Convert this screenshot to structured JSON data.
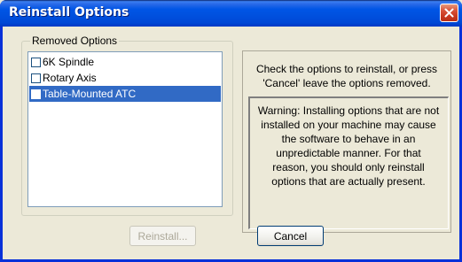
{
  "window": {
    "title": "Reinstall Options"
  },
  "group": {
    "label": "Removed Options",
    "items": [
      {
        "label": "6K Spindle",
        "checked": false,
        "selected": false
      },
      {
        "label": "Rotary Axis",
        "checked": false,
        "selected": false
      },
      {
        "label": "Table-Mounted ATC",
        "checked": false,
        "selected": true
      }
    ]
  },
  "info": {
    "line1": "Check the options to reinstall, or press",
    "line2": "'Cancel' leave the options removed."
  },
  "warning": {
    "lines": [
      "Warning: Installing options that are not",
      "installed on your machine may cause",
      "the software to behave in an",
      "unpredictable manner.  For that",
      "reason, you should only reinstall",
      "options that are actually present."
    ]
  },
  "buttons": {
    "reinstall": "Reinstall...",
    "cancel": "Cancel"
  },
  "colors": {
    "titlebar": "#0055E5",
    "selection": "#316AC5",
    "face": "#ECE9D8",
    "close": "#D9543A"
  }
}
